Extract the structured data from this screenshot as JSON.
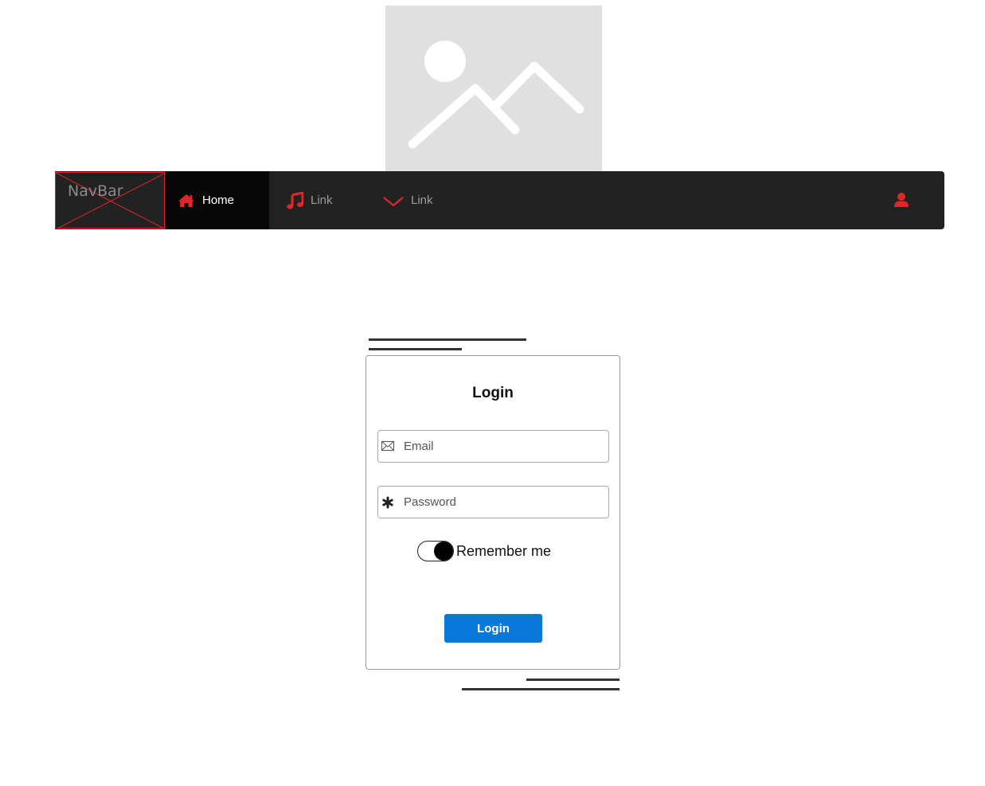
{
  "navbar": {
    "brand": "NavBar",
    "items": [
      {
        "label": "Home",
        "icon": "home-icon",
        "active": true
      },
      {
        "label": "Link",
        "icon": "music-icon",
        "active": false
      },
      {
        "label": "Link",
        "icon": "chevron-down-icon",
        "active": false
      }
    ],
    "user_icon": "user-icon",
    "accent_color": "#e0262a",
    "background_color": "#222222"
  },
  "hero": {
    "icon": "image-placeholder-icon"
  },
  "login": {
    "title": "Login",
    "email": {
      "placeholder": "Email",
      "value": "",
      "icon": "envelope-icon"
    },
    "password": {
      "placeholder": "Password",
      "value": "",
      "icon": "asterisk-icon"
    },
    "remember_label": "Remember me",
    "remember_checked": true,
    "submit_label": "Login",
    "button_color": "#0a78d8"
  }
}
